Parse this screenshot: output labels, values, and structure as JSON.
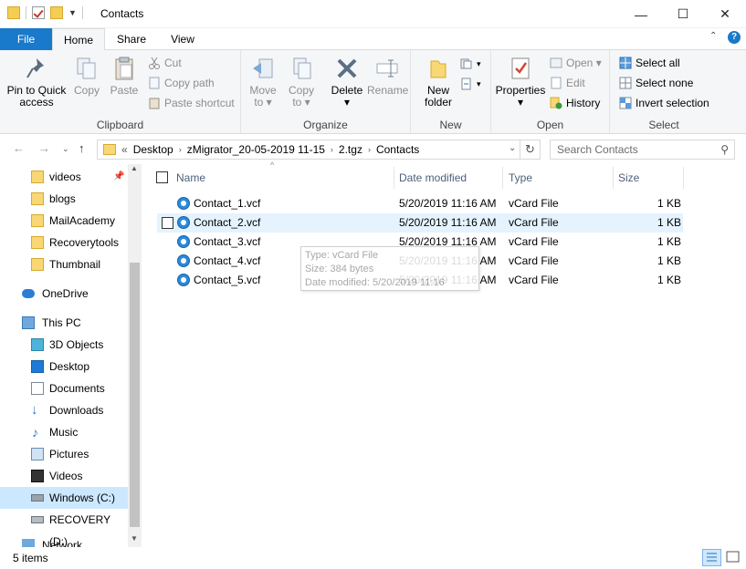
{
  "window": {
    "title": "Contacts",
    "minimize": "—",
    "maximize": "☐",
    "close": "✕"
  },
  "tabs": [
    {
      "label": "File"
    },
    {
      "label": "Home"
    },
    {
      "label": "Share"
    },
    {
      "label": "View"
    }
  ],
  "ribbon": {
    "clipboard": {
      "label": "Clipboard",
      "pin": "Pin to Quick\naccess",
      "copy": "Copy",
      "paste": "Paste",
      "cut": "Cut",
      "copy_path": "Copy path",
      "paste_shortcut": "Paste shortcut"
    },
    "organize": {
      "label": "Organize",
      "move_to": "Move\nto ▾",
      "copy_to": "Copy\nto ▾",
      "delete": "Delete\n▾",
      "rename": "Rename"
    },
    "new": {
      "label": "New",
      "new_folder": "New\nfolder"
    },
    "open": {
      "label": "Open",
      "properties": "Properties\n▾",
      "open": "Open ▾",
      "edit": "Edit",
      "history": "History"
    },
    "select": {
      "label": "Select",
      "select_all": "Select all",
      "select_none": "Select none",
      "invert_selection": "Invert selection"
    }
  },
  "address": {
    "overflow": "«",
    "crumbs": [
      "Desktop",
      "zMigrator_20-05-2019 11-15",
      "2.tgz",
      "Contacts"
    ],
    "search_placeholder": "Search Contacts"
  },
  "nav": {
    "items": [
      {
        "label": "videos",
        "pinned": true
      },
      {
        "label": "blogs"
      },
      {
        "label": "MailAcademy"
      },
      {
        "label": "Recoverytools"
      },
      {
        "label": "Thumbnail"
      },
      {
        "label": "OneDrive"
      },
      {
        "label": "This PC"
      },
      {
        "label": "3D Objects"
      },
      {
        "label": "Desktop"
      },
      {
        "label": "Documents"
      },
      {
        "label": "Downloads"
      },
      {
        "label": "Music"
      },
      {
        "label": "Pictures"
      },
      {
        "label": "Videos"
      },
      {
        "label": "Windows (C:)"
      },
      {
        "label": "RECOVERY (D:)"
      },
      {
        "label": "Network"
      }
    ]
  },
  "columns": {
    "name": "Name",
    "date": "Date modified",
    "type": "Type",
    "size": "Size"
  },
  "files": [
    {
      "name": "Contact_1.vcf",
      "date": "5/20/2019 11:16 AM",
      "type": "vCard File",
      "size": "1 KB"
    },
    {
      "name": "Contact_2.vcf",
      "date": "5/20/2019 11:16 AM",
      "type": "vCard File",
      "size": "1 KB"
    },
    {
      "name": "Contact_3.vcf",
      "date": "5/20/2019 11:16 AM",
      "type": "vCard File",
      "size": "1 KB"
    },
    {
      "name": "Contact_4.vcf",
      "date": "5/20/2019 11:16 AM",
      "type": "vCard File",
      "size": "1 KB"
    },
    {
      "name": "Contact_5.vcf",
      "date": "5/20/2019 11:16 AM",
      "type": "vCard File",
      "size": "1 KB"
    }
  ],
  "tooltip": {
    "type": "Type: vCard File",
    "size": "Size: 384 bytes",
    "date": "Date modified: 5/20/2019 11:16"
  },
  "status": {
    "count": "5 items"
  }
}
